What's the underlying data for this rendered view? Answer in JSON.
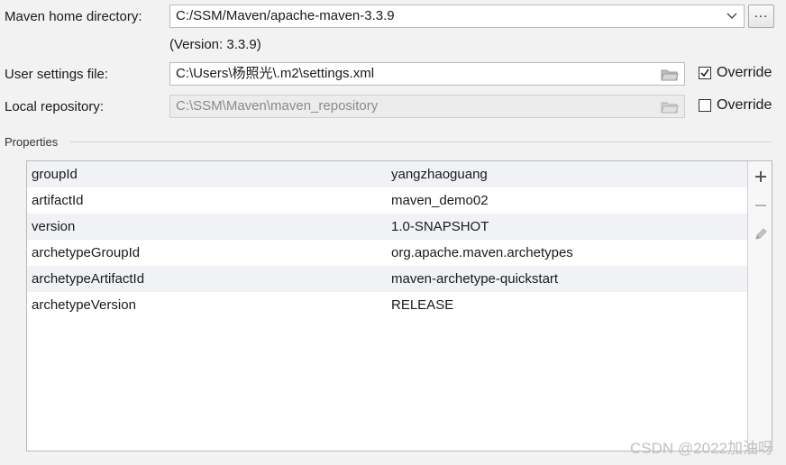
{
  "maven_home": {
    "label": "Maven home directory:",
    "value": "C:/SSM/Maven/apache-maven-3.3.9",
    "browse_label": "...",
    "version_note": "(Version: 3.3.9)"
  },
  "user_settings": {
    "label": "User settings file:",
    "value": "C:\\Users\\杨照光\\.m2\\settings.xml",
    "override_label": "Override",
    "override_checked": true
  },
  "local_repository": {
    "label": "Local repository:",
    "value": "C:\\SSM\\Maven\\maven_repository",
    "override_label": "Override",
    "override_checked": false
  },
  "properties": {
    "section_title": "Properties",
    "rows": [
      {
        "key": "groupId",
        "value": "yangzhaoguang"
      },
      {
        "key": "artifactId",
        "value": "maven_demo02"
      },
      {
        "key": "version",
        "value": "1.0-SNAPSHOT"
      },
      {
        "key": "archetypeGroupId",
        "value": "org.apache.maven.archetypes"
      },
      {
        "key": "archetypeArtifactId",
        "value": "maven-archetype-quickstart"
      },
      {
        "key": "archetypeVersion",
        "value": "RELEASE"
      }
    ],
    "toolbar": {
      "add_icon": "plus-icon",
      "remove_icon": "minus-icon",
      "edit_icon": "pencil-icon"
    }
  },
  "watermark": "CSDN @2022加油呀",
  "colors": {
    "background": "#f2f2f2",
    "row_alt": "#f0f2f6",
    "border": "#b9b9b9"
  }
}
